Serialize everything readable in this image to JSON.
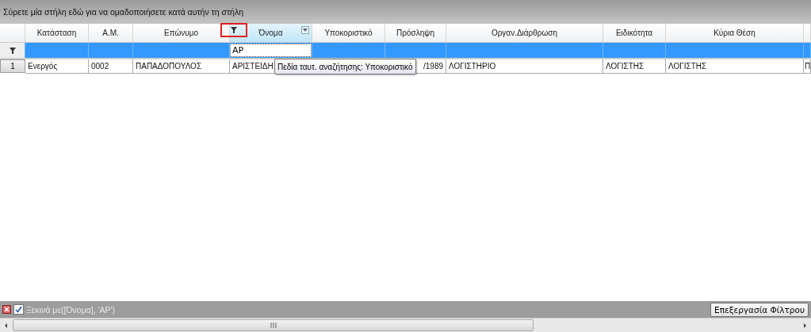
{
  "group_panel": {
    "hint": "Σύρετε μία στήλη εδώ για να ομαδοποιήσετε κατά αυτήν τη στήλη"
  },
  "columns": [
    {
      "label": "Κατάσταση",
      "selected": false
    },
    {
      "label": "Α.Μ.",
      "selected": false
    },
    {
      "label": "Επώνυμο",
      "selected": false
    },
    {
      "label": "Όνομα",
      "selected": true,
      "filter_value": "ΑΡ"
    },
    {
      "label": "Υποκοριστικό",
      "selected": false
    },
    {
      "label": "Πρόσληψη",
      "selected": false
    },
    {
      "label": "Οργαν.Διάρθρωση",
      "selected": false
    },
    {
      "label": "Ειδικότητα",
      "selected": false
    },
    {
      "label": "Κύρια Θέση",
      "selected": false
    }
  ],
  "rows": [
    {
      "number": "1",
      "cells": [
        "Ενεργός",
        "0002",
        "ΠΑΠΑΔΟΠΟΥΛΟΣ",
        "ΑΡΙΣΤΕΙΔΗ",
        "",
        "/1989",
        "ΛΟΓΙΣΤΗΡΙΟ",
        "ΛΟΓΙΣΤΗΣ",
        "ΛΟΓΙΣΤΗΣ",
        "Π"
      ]
    }
  ],
  "tooltip": {
    "text": "Πεδία ταυτ. αναζήτησης: Υποκοριστικό"
  },
  "filter_bar": {
    "enabled": true,
    "expression": "Ξεκινά με([Όνομα], 'ΑΡ')",
    "button": "Επεξεργασία Φίλτρου"
  }
}
